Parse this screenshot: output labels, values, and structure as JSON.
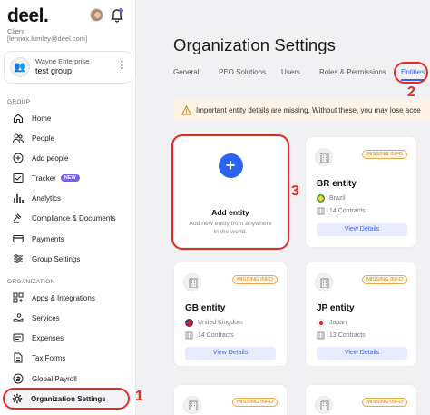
{
  "app": {
    "logo": "deel.",
    "client_label": "Client",
    "client_email": "[lennox.lumley@deel.com]"
  },
  "group_card": {
    "company": "Wayne Enterprise",
    "group": "test group"
  },
  "sidebar": {
    "group_section": "GROUP",
    "group_items": [
      {
        "label": "Home",
        "icon": "home-icon"
      },
      {
        "label": "People",
        "icon": "people-icon"
      },
      {
        "label": "Add people",
        "icon": "add-icon"
      },
      {
        "label": "Tracker",
        "icon": "tracker-icon",
        "badge": "NEW"
      },
      {
        "label": "Analytics",
        "icon": "analytics-icon"
      },
      {
        "label": "Compliance & Documents",
        "icon": "gavel-icon"
      },
      {
        "label": "Payments",
        "icon": "card-icon"
      },
      {
        "label": "Group Settings",
        "icon": "sliders-icon"
      }
    ],
    "org_section": "ORGANIZATION",
    "org_items": [
      {
        "label": "Apps & Integrations",
        "icon": "apps-icon"
      },
      {
        "label": "Services",
        "icon": "services-icon"
      },
      {
        "label": "Expenses",
        "icon": "expenses-icon"
      },
      {
        "label": "Tax Forms",
        "icon": "tax-forms-icon"
      },
      {
        "label": "Global Payroll",
        "icon": "global-payroll-icon"
      },
      {
        "label": "Organization Settings",
        "icon": "gear-icon"
      }
    ]
  },
  "main": {
    "title": "Organization Settings",
    "tabs": [
      "General",
      "PEO Solutions",
      "Users",
      "Roles & Permissions",
      "Entities"
    ],
    "active_tab": "Entities",
    "banner": "Important entity details are missing. Without these, you may lose acce"
  },
  "add_entity": {
    "title": "Add entity",
    "subtitle_line1": "Add new entity from anywhere",
    "subtitle_line2": "in the world."
  },
  "entities": [
    {
      "name": "BR entity",
      "country": "Brazil",
      "contracts": "14 Contracts",
      "badge": "MISSING INFO",
      "button": "View Details"
    },
    {
      "name": "GB entity",
      "country": "United Kingdom",
      "contracts": "14 Contracts",
      "badge": "MISSING INFO",
      "button": "View Details"
    },
    {
      "name": "JP entity",
      "country": "Japan",
      "contracts": "13 Contracts",
      "badge": "MISSING INFO",
      "button": "View Details"
    },
    {
      "badge": "MISSING INFO"
    },
    {
      "badge": "MISSING INFO"
    }
  ],
  "annotations": [
    "1",
    "2",
    "3"
  ],
  "colors": {
    "accent": "#2b63f3",
    "annotation": "#e22a20",
    "badge": "#d4850b",
    "new_badge": "#7b5cf0"
  }
}
